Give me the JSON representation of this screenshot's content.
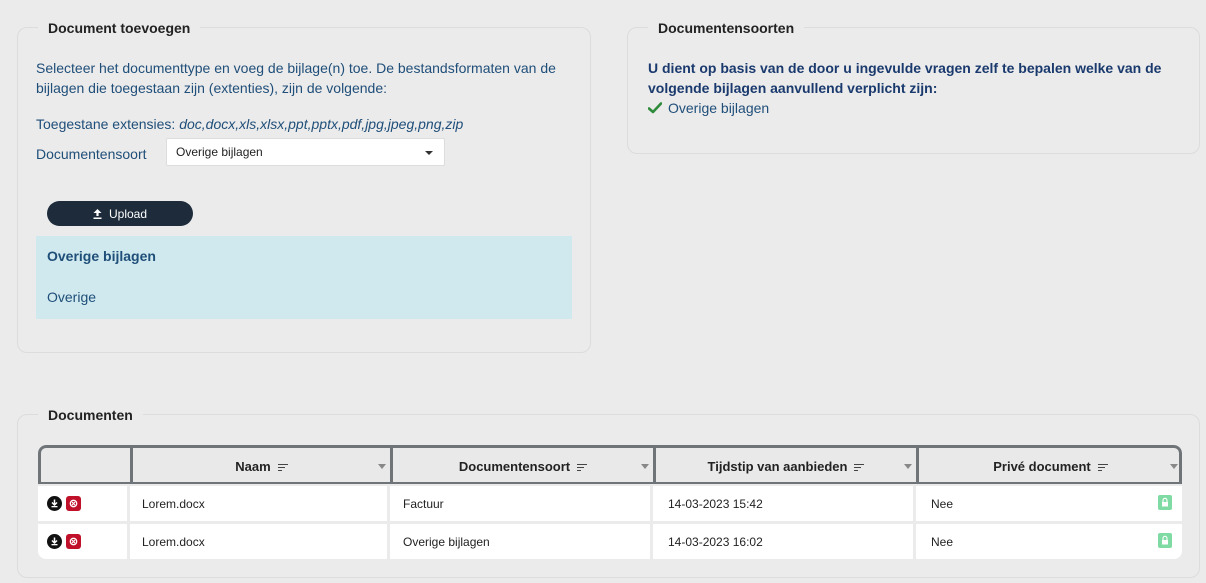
{
  "add_panel": {
    "title": "Document toevoegen",
    "intro": "Selecteer het documenttype en voeg de bijlage(n) toe. De bestandsformaten van de bijlagen die toegestaan zijn (extenties), zijn de volgende:",
    "extensions_label": "Toegestane extensies:",
    "extensions_value": "doc,docx,xls,xlsx,ppt,pptx,pdf,jpg,jpeg,png,zip",
    "doctype_label": "Documentensoort",
    "doctype_value": "Overige bijlagen",
    "upload_label": "Upload",
    "info_title": "Overige bijlagen",
    "info_text": "Overige"
  },
  "types_panel": {
    "title": "Documentensoorten",
    "text": "U dient op basis van de door u ingevulde vragen zelf te bepalen welke van de volgende bijlagen aanvullend verplicht zijn:",
    "item": "Overige bijlagen"
  },
  "documents": {
    "title": "Documenten",
    "columns": [
      "Naam",
      "Documentensoort",
      "Tijdstip van aanbieden",
      "Privé document"
    ],
    "rows": [
      {
        "naam": "Lorem.docx",
        "soort": "Factuur",
        "tijdstip": "14-03-2023 15:42",
        "prive": "Nee"
      },
      {
        "naam": "Lorem.docx",
        "soort": "Overige bijlagen",
        "tijdstip": "14-03-2023 16:02",
        "prive": "Nee"
      }
    ]
  },
  "colors": {
    "text_blue": "#1f4e79",
    "button_dark": "#1d2b3a",
    "info_bg": "#cfe9ee",
    "check_green": "#2e8b3a",
    "delete_red": "#c0102a",
    "lock_green": "#7fdba3"
  },
  "icons": [
    "upload-icon",
    "check-icon",
    "sort-icon",
    "filter-icon",
    "download-icon",
    "delete-icon",
    "lock-icon",
    "chevron-down-icon"
  ]
}
